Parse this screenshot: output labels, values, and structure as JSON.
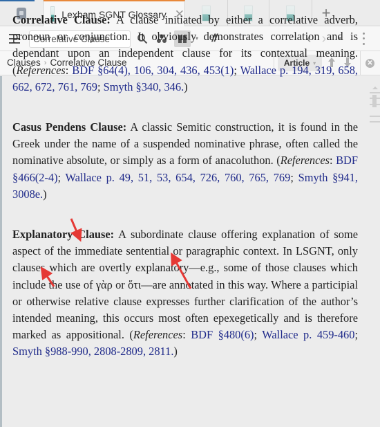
{
  "tabs": {
    "home_icon": "home-icon",
    "active": {
      "title": "Lexham SGNT Glossary",
      "icon": "book-icon",
      "close": "✕"
    },
    "others": [
      {
        "icon": "book-icon"
      },
      {
        "icon": "book-icon"
      },
      {
        "icon": "book-icon"
      }
    ],
    "new_tab": "+"
  },
  "toolbar": {
    "search_value": "Correlative Clause",
    "slash_label": "//",
    "back": "‹",
    "forward": "›",
    "dropdown": "▾"
  },
  "breadcrumb": {
    "items": [
      "Clauses",
      "Correlative Clause"
    ],
    "separator": "›"
  },
  "panel": {
    "article_label": "Article",
    "article_dropdown": "▾",
    "up_arrow": "🡅",
    "down_arrow": "🡇",
    "close": "✕"
  },
  "entries": [
    {
      "term": "Correlative Clause:",
      "definition": " A clause initiated by either a correlative adverb, pronoun or conjunction. It obviously demonstrates correlation and is dependant upon an independent clause for its contextual meaning. ",
      "refs_open": "(",
      "refs_label": "References",
      "refs_colon": ": ",
      "refs": [
        {
          "source": "BDF",
          "text": " §64(4), 106, 304, 436, 453(1)",
          "sep": "; "
        },
        {
          "source": "Wallace",
          "text": " p. 194, 319, 658, 662, 672, 761, 769",
          "sep": "; "
        },
        {
          "source": "Smyth",
          "text": " §340, 346.",
          "sep": ")"
        }
      ]
    },
    {
      "term": "Casus Pendens Clause:",
      "definition": " A classic Semitic construction, it is found in the Greek under the name of a suspended nominative phrase, often called the nominative absolute, or simply as a form of anacoluthon. ",
      "refs_open": "(",
      "refs_label": "References",
      "refs_colon": ": ",
      "refs": [
        {
          "source": "BDF",
          "text": " §466(2-4)",
          "sep": ";  "
        },
        {
          "source": "Wallace",
          "text": " p. 49, 51, 53, 654, 726, 760, 765, 769",
          "sep": "; "
        },
        {
          "source": "Smyth",
          "text": " §941, 3008e.",
          "sep": ")"
        }
      ]
    },
    {
      "term": "Explanatory Clause:",
      "definition": " A subordinate clause offering explanation of some aspect of the immediate sentential or paragraphic context. In LSGNT, only clauses which are overtly explanatory—e.g., some of those clauses which include the use of γὰρ or ὅτι—are annotated in this way. Where a participial or otherwise relative clause expresses further clarification of the author’s intended meaning, this occurs most often epexegetically and is therefore marked as appositional.  ",
      "refs_open": "(",
      "refs_label": "References",
      "refs_colon": ": ",
      "refs": [
        {
          "source": "BDF",
          "text": " §480(6)",
          "sep": "; "
        },
        {
          "source": "Wallace",
          "text": " p. 459-460",
          "sep": "; "
        },
        {
          "source": "Smyth",
          "text": " §988-990, 2808-2809, 2811.",
          "sep": ")"
        }
      ]
    }
  ],
  "annotations": {
    "arrow_color": "#e53935",
    "count": 3
  }
}
